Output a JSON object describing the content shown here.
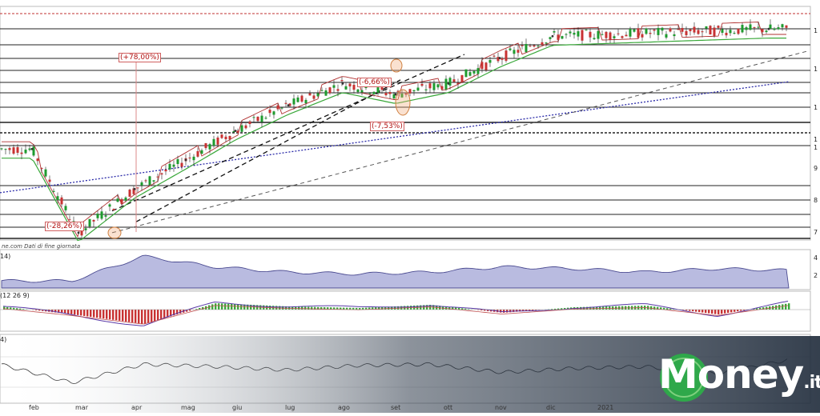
{
  "source_note": "ne.com Dati di fine giornata",
  "brand": {
    "name": "Money",
    "suffix": ".it",
    "accent": "#2fa84a"
  },
  "colors": {
    "up": "#1e9b2e",
    "down": "#c83232",
    "mavg": "#3aa83a",
    "sar": "#b03030",
    "trend": "#222222",
    "longtrend": "#2a2aa8",
    "volume_fill": "#b9bbe0",
    "hist_up": "#3aa83a",
    "hist_down": "#c83232"
  },
  "panel_tags": {
    "volatility": "14)",
    "macd": "(12 26 9)",
    "rsi": "4)"
  },
  "annotations": {
    "gain": "(+78,00%)",
    "drop1": "(-28,26%)",
    "drop2": "(-6,66%)",
    "drop3": "(-7,53%)"
  },
  "y_axis_labels": [
    "1",
    "1",
    "1",
    "1",
    "1",
    "9",
    "8",
    "7"
  ],
  "sub_axis_labels": {
    "vol_top": "4",
    "vol_mid": "2"
  },
  "chart_data": [
    {
      "type": "candlestick",
      "title": "",
      "x": [
        "feb",
        "mar",
        "apr",
        "mag",
        "giu",
        "lug",
        "ago",
        "set",
        "ott",
        "nov",
        "dic",
        "2021"
      ],
      "trend": "rally from March low to year-end high",
      "close_series": [
        {
          "month": "feb",
          "close": 95.0
        },
        {
          "month": "mar",
          "close": 72.0
        },
        {
          "month": "apr",
          "close": 84.0
        },
        {
          "month": "mag",
          "close": 92.0
        },
        {
          "month": "giu",
          "close": 100.0
        },
        {
          "month": "lug",
          "close": 107.0
        },
        {
          "month": "ago",
          "close": 113.0
        },
        {
          "month": "set",
          "close": 110.0
        },
        {
          "month": "ott",
          "close": 113.0
        },
        {
          "month": "nov",
          "close": 120.0
        },
        {
          "month": "dic",
          "close": 126.0
        },
        {
          "month": "2021",
          "close": 128.0
        }
      ],
      "ylim": [
        70,
        132
      ],
      "grid": true
    },
    {
      "type": "area",
      "name": "volatility",
      "values": [
        0.2,
        0.2,
        0.9,
        0.6,
        0.45,
        0.4,
        0.45,
        0.6,
        0.55,
        0.45,
        0.55,
        0.5
      ]
    },
    {
      "type": "bar",
      "name": "macd",
      "values": [
        0.2,
        -0.3,
        -0.9,
        0.4,
        0.2,
        0.1,
        0.3,
        -0.2,
        0.15,
        0.25,
        -0.3,
        0.4
      ]
    },
    {
      "type": "line",
      "name": "rsi",
      "values": [
        0.62,
        0.3,
        0.62,
        0.58,
        0.52,
        0.6,
        0.62,
        0.48,
        0.55,
        0.58,
        0.45,
        0.7
      ]
    }
  ]
}
